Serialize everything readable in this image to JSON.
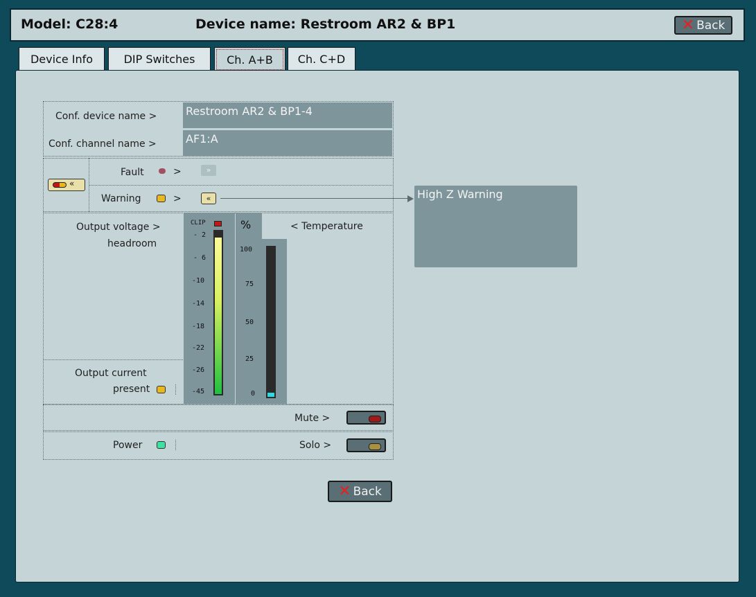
{
  "header": {
    "model": "Model: C28:4",
    "device_name": "Device name: Restroom AR2 & BP1",
    "back_label": "Back"
  },
  "tabs": [
    {
      "label": "Device Info",
      "active": false
    },
    {
      "label": "DIP Switches",
      "active": false
    },
    {
      "label": "Ch. A+B",
      "active": true
    },
    {
      "label": "Ch. C+D",
      "active": false
    }
  ],
  "config": {
    "device_name_label": "Conf. device name >",
    "device_name_value": "Restroom AR2 & BP1-4",
    "channel_name_label": "Conf. channel name >",
    "channel_name_value": "AF1:A"
  },
  "status": {
    "fault_label": "Fault",
    "warning_label": "Warning",
    "arrow": ">",
    "warning_message": "High Z Warning"
  },
  "meters": {
    "headroom_label_1": "Output voltage >",
    "headroom_label_2": "headroom",
    "clip_label": "CLIP",
    "headroom_ticks": [
      "- 2",
      "- 6",
      "-10",
      "-14",
      "-18",
      "-22",
      "-26",
      "-45"
    ],
    "headroom_level": 0.96,
    "percent_label": "%",
    "temperature_label": "< Temperature",
    "temperature_ticks": [
      "100",
      "75",
      "50",
      "25",
      "0"
    ],
    "temperature_level": 0.03,
    "current_label_1": "Output current",
    "current_label_2": "present"
  },
  "controls": {
    "mute_label": "Mute >",
    "power_label": "Power",
    "solo_label": "Solo >",
    "back_label": "Back"
  },
  "colors": {
    "fault_led": "#a05060",
    "warning_led": "#e8b820",
    "power_led": "#40e0a0",
    "current_led": "#e8b820",
    "mute_nub": "#a01818",
    "solo_nub": "#a89040",
    "meter_top": "#fbfb9a",
    "meter_bottom": "#20c040",
    "temperature_bar": "#30d8e0"
  },
  "icons": {
    "back": "red-x-icon",
    "fault_action": "double-chevron-right-icon",
    "warning_action": "double-chevron-left-icon",
    "status_badge": "fault-warning-indicator-icon"
  }
}
